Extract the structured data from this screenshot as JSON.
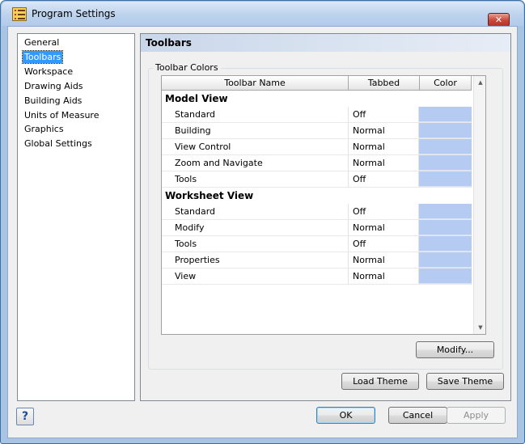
{
  "window": {
    "title": "Program Settings",
    "close_label": "✕"
  },
  "nav": {
    "items": [
      {
        "label": "General",
        "selected": false
      },
      {
        "label": "Toolbars",
        "selected": true
      },
      {
        "label": "Workspace",
        "selected": false
      },
      {
        "label": "Drawing Aids",
        "selected": false
      },
      {
        "label": "Building Aids",
        "selected": false
      },
      {
        "label": "Units of Measure",
        "selected": false
      },
      {
        "label": "Graphics",
        "selected": false
      },
      {
        "label": "Global Settings",
        "selected": false
      }
    ]
  },
  "content": {
    "header": "Toolbars",
    "group_label": "Toolbar Colors",
    "columns": [
      "Toolbar Name",
      "Tabbed",
      "Color"
    ],
    "swatch_color": "#b5cbf1",
    "groups": [
      {
        "title": "Model View",
        "rows": [
          {
            "name": "Standard",
            "tabbed": "Off"
          },
          {
            "name": "Building",
            "tabbed": "Normal"
          },
          {
            "name": "View Control",
            "tabbed": "Normal"
          },
          {
            "name": "Zoom and Navigate",
            "tabbed": "Normal"
          },
          {
            "name": "Tools",
            "tabbed": "Off"
          }
        ]
      },
      {
        "title": "Worksheet View",
        "rows": [
          {
            "name": "Standard",
            "tabbed": "Off"
          },
          {
            "name": "Modify",
            "tabbed": "Normal"
          },
          {
            "name": "Tools",
            "tabbed": "Off"
          },
          {
            "name": "Properties",
            "tabbed": "Normal"
          },
          {
            "name": "View",
            "tabbed": "Normal"
          }
        ]
      }
    ],
    "modify_label": "Modify...",
    "load_theme_label": "Load Theme",
    "save_theme_label": "Save Theme"
  },
  "footer": {
    "help_label": "?",
    "ok_label": "OK",
    "cancel_label": "Cancel",
    "apply_label": "Apply"
  }
}
